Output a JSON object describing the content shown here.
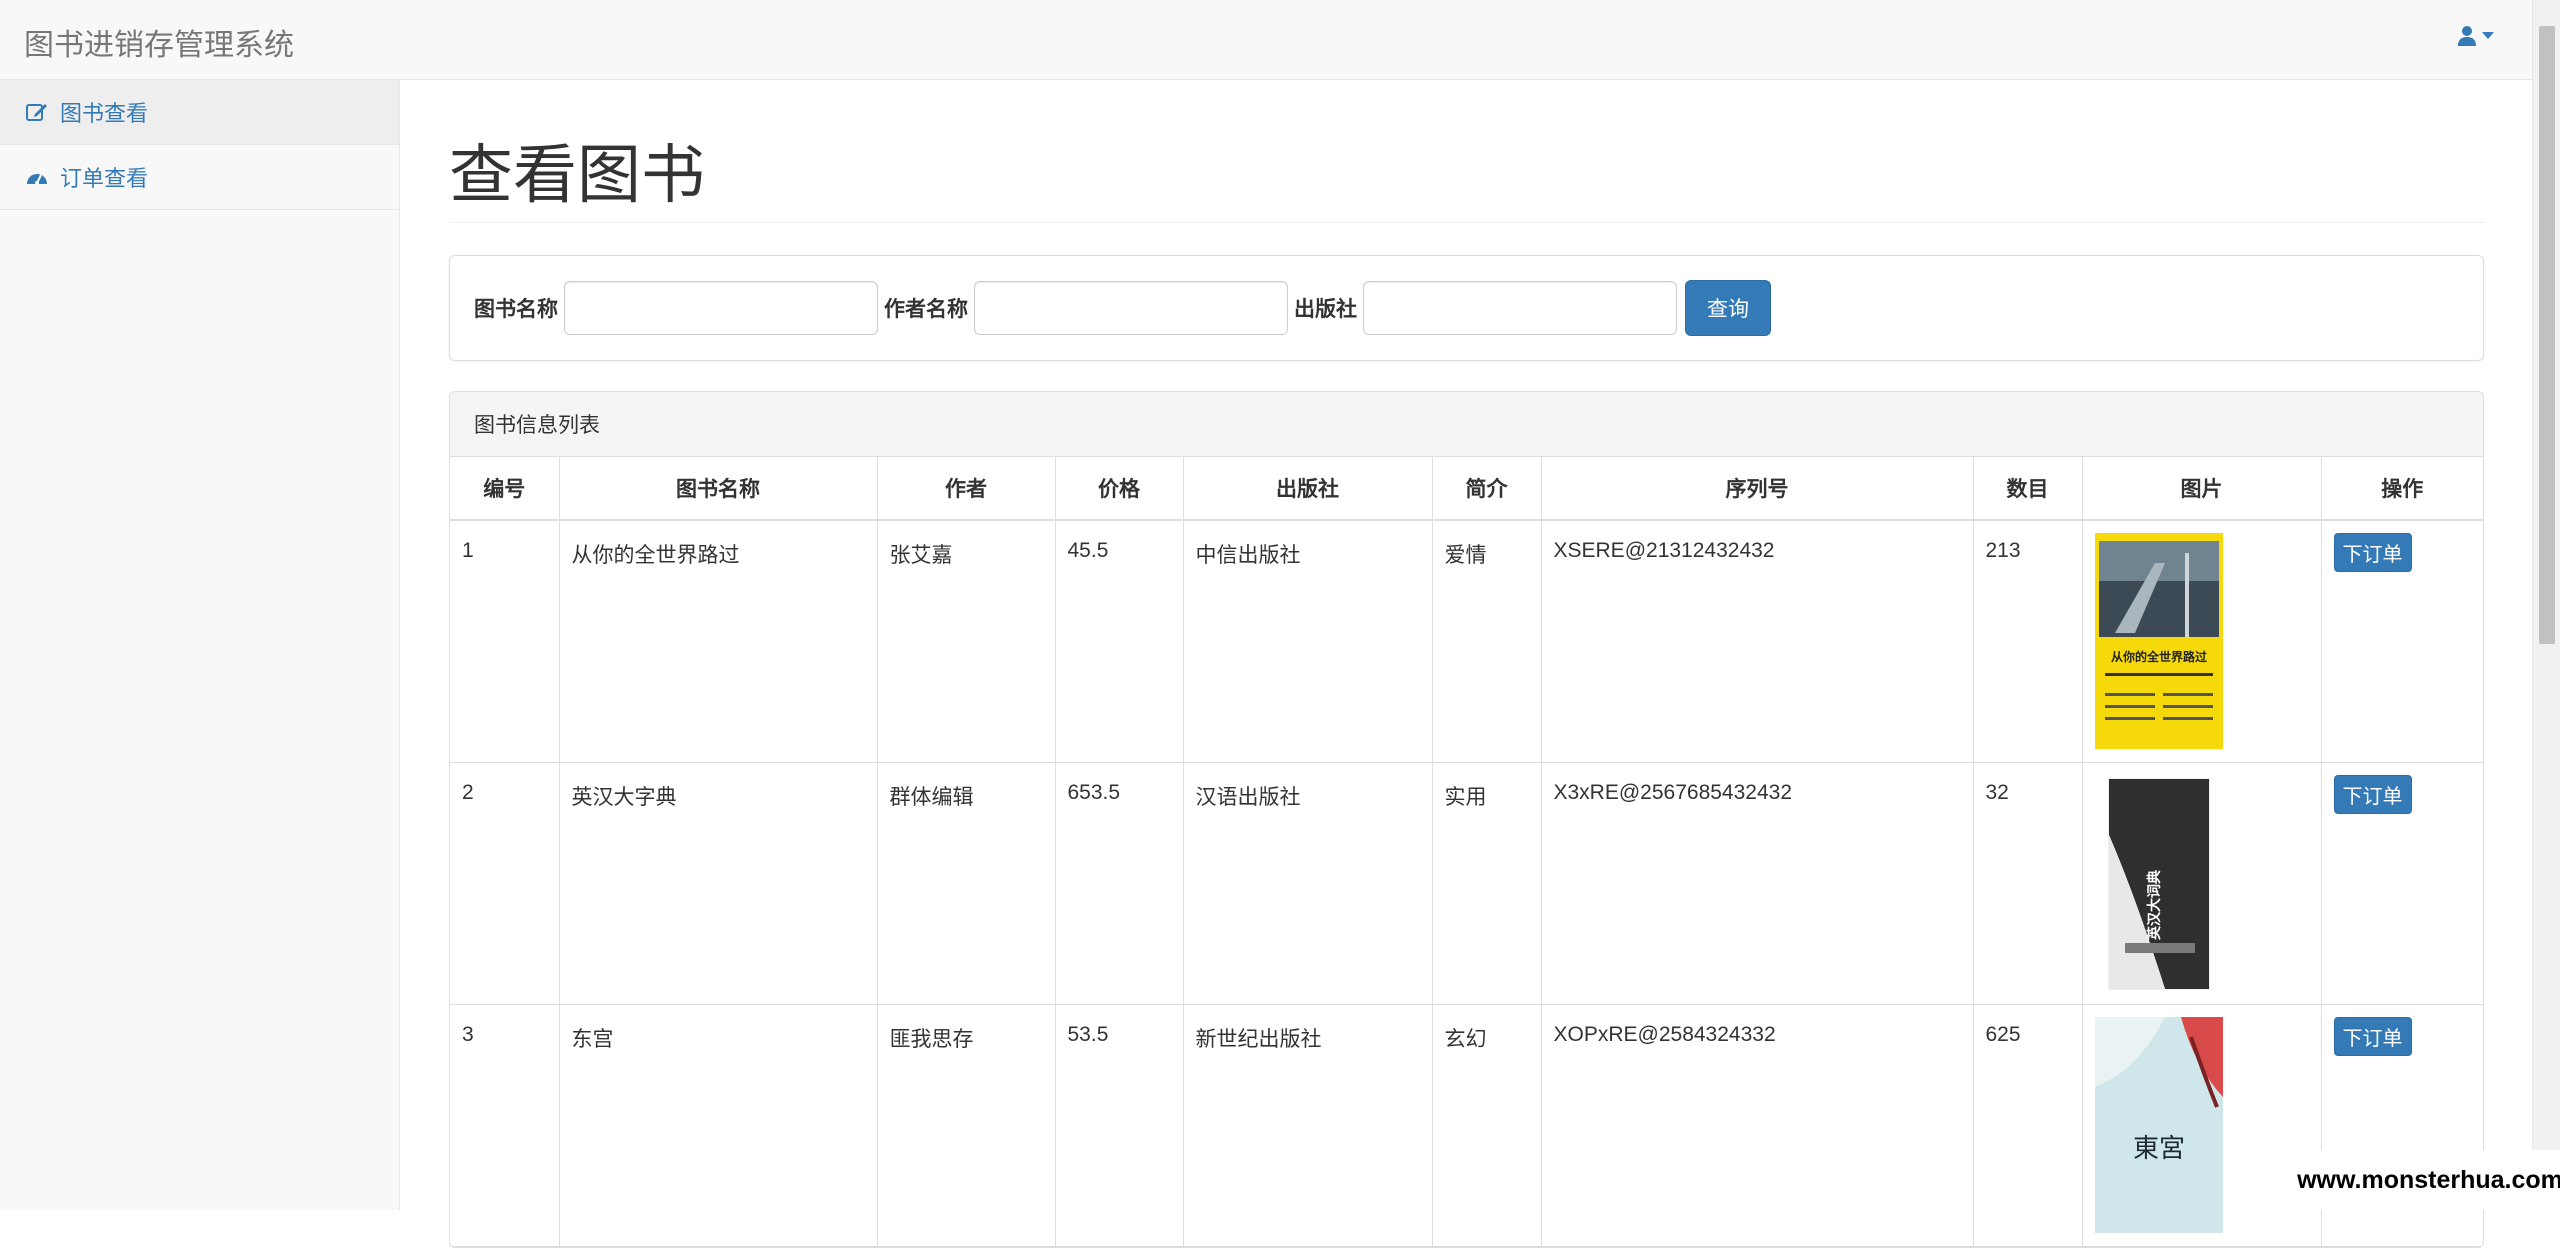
{
  "app": {
    "title": "图书进销存管理系统"
  },
  "sidebar": {
    "items": [
      {
        "label": "图书查看",
        "icon": "edit-icon",
        "active": true
      },
      {
        "label": "订单查看",
        "icon": "dashboard-icon",
        "active": false
      }
    ]
  },
  "main": {
    "page_title": "查看图书"
  },
  "search": {
    "book_name_label": "图书名称",
    "author_label": "作者名称",
    "publisher_label": "出版社",
    "book_name_value": "",
    "author_value": "",
    "publisher_value": "",
    "query_button": "查询"
  },
  "table": {
    "panel_title": "图书信息列表",
    "headers": [
      "编号",
      "图书名称",
      "作者",
      "价格",
      "出版社",
      "简介",
      "序列号",
      "数目",
      "图片",
      "操作"
    ],
    "rows": [
      {
        "id": "1",
        "name": "从你的全世界路过",
        "author": "张艾嘉",
        "price": "45.5",
        "publisher": "中信出版社",
        "intro": "爱情",
        "serial": "XSERE@21312432432",
        "count": "213",
        "order_button": "下订单",
        "cover_title": "从你的全世界路过"
      },
      {
        "id": "2",
        "name": "英汉大字典",
        "author": "群体编辑",
        "price": "653.5",
        "publisher": "汉语出版社",
        "intro": "实用",
        "serial": "X3xRE@2567685432432",
        "count": "32",
        "order_button": "下订单",
        "cover_title": "英汉大词典"
      },
      {
        "id": "3",
        "name": "东宫",
        "author": "匪我思存",
        "price": "53.5",
        "publisher": "新世纪出版社",
        "intro": "玄幻",
        "serial": "XOPxRE@2584324332",
        "count": "625",
        "order_button": "下订单",
        "cover_title": "東宮"
      }
    ]
  },
  "watermark": "www.monsterhua.com",
  "colors": {
    "primary": "#337ab7",
    "navbar_bg": "#f8f8f8",
    "border": "#dddddd"
  }
}
